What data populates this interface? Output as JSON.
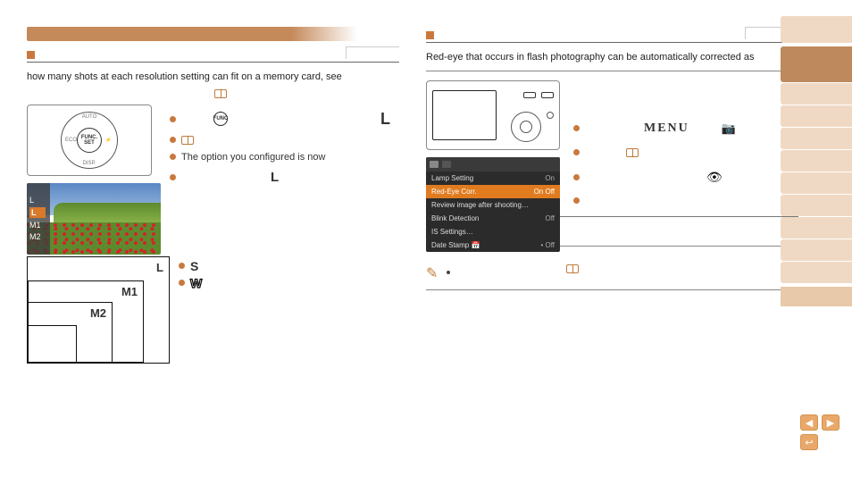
{
  "left": {
    "para_intro": "how many shots at each resolution setting can fit on a memory card, see",
    "dial": {
      "top": "AUTO",
      "left": "ECO",
      "right": "⚡",
      "bottom": "DISP.",
      "center": "FUNC. SET"
    },
    "thumb_labels": [
      "L",
      "L",
      "M1",
      "M2"
    ],
    "bullet_big_L1": "L",
    "bullet_text": "The option you configured is now",
    "bullet_big_L2": "L",
    "guide": {
      "L": "L",
      "M1": "M1",
      "M2": "M2"
    },
    "list": {
      "S": "S",
      "W": "W"
    }
  },
  "right": {
    "para": "Red-eye that occurs in flash photography can be automatically corrected as",
    "menu_word": "MENU",
    "cam_glyph": "📷",
    "eye_glyph": "👁",
    "sim": {
      "rows": [
        {
          "label": "Lamp Setting",
          "val": "On",
          "hl": false
        },
        {
          "label": "Red-Eye Corr.",
          "val": "On  Off",
          "hl": true
        },
        {
          "label": "Review image after shooting…",
          "val": "",
          "hl": false
        },
        {
          "label": "Blink Detection",
          "val": "Off",
          "hl": false
        },
        {
          "label": "IS Settings…",
          "val": "",
          "hl": false
        },
        {
          "label": "Date Stamp 📅",
          "val": "• Off",
          "hl": false
        }
      ]
    },
    "warn": "!",
    "pen": "✎"
  },
  "nav": {
    "prev": "◀",
    "next": "▶",
    "ret": "↩"
  }
}
